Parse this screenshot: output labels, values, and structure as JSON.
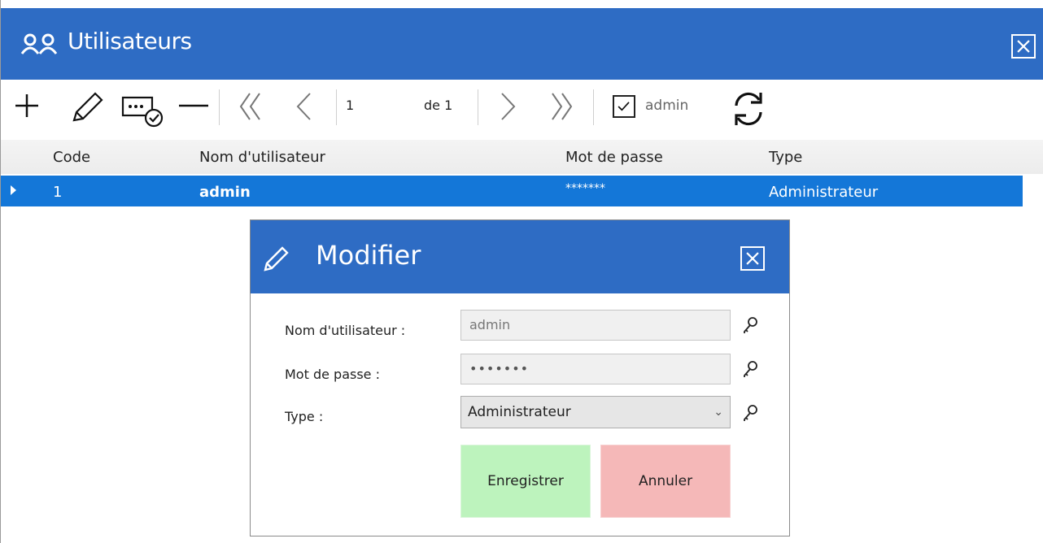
{
  "window": {
    "title": "Utilisateurs",
    "title_icon": "users-icon",
    "close_icon": "close-icon"
  },
  "toolbar": {
    "add_icon": "plus-icon",
    "edit_icon": "pencil-icon",
    "password_icon": "password-check-icon",
    "delete_icon": "minus-icon",
    "first_icon": "double-chevron-left-icon",
    "prev_icon": "chevron-left-icon",
    "page_value": "1",
    "page_of": "de 1",
    "next_icon": "chevron-right-icon",
    "last_icon": "double-chevron-right-icon",
    "filter_checked": true,
    "filter_label": "admin",
    "refresh_icon": "refresh-icon"
  },
  "grid": {
    "headers": [
      "Code",
      "Nom d'utilisateur",
      "Mot de passe",
      "Type"
    ],
    "rows": [
      [
        "1",
        "admin",
        "*******",
        "Administrateur"
      ]
    ]
  },
  "modal": {
    "title": "Modifier",
    "title_icon": "pencil-icon",
    "username_label": "Nom d'utilisateur :",
    "username_value": "admin",
    "password_label": "Mot de passe :",
    "password_value": "•••••••",
    "type_label": "Type :",
    "type_value": "Administrateur",
    "key_icon": "key-icon",
    "save_label": "Enregistrer",
    "cancel_label": "Annuler"
  },
  "colors": {
    "title_bar": "#2e6cc4",
    "selected_row": "#1477d8",
    "save_button": "#bdf3bd",
    "cancel_button": "#f5b8b8"
  }
}
